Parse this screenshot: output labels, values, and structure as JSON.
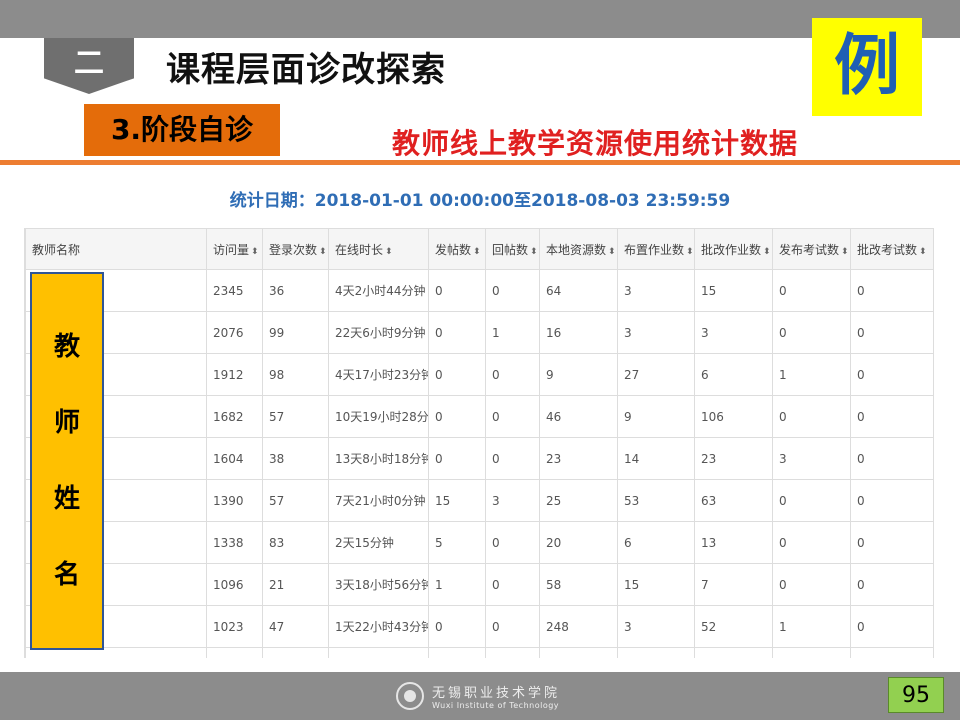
{
  "header": {
    "section_number": "二",
    "main_title": "课程层面诊改探索",
    "example_label": "例",
    "subsection": "3.阶段自诊",
    "subtitle": "教师线上教学资源使用统计数据"
  },
  "stats": {
    "date_range": "统计日期：2018-01-01 00:00:00至2018-08-03 23:59:59"
  },
  "table": {
    "columns": [
      "教师名称",
      "访问量",
      "登录次数",
      "在线时长",
      "发帖数",
      "回帖数",
      "本地资源数",
      "布置作业数",
      "批改作业数",
      "发布考试数",
      "批改考试数"
    ],
    "sortable": [
      false,
      true,
      true,
      true,
      true,
      true,
      true,
      true,
      true,
      true,
      true
    ],
    "sort_icon": "sort-updown-icon",
    "rows": [
      [
        "",
        "2345",
        "36",
        "4天2小时44分钟",
        "0",
        "0",
        "64",
        "3",
        "15",
        "0",
        "0"
      ],
      [
        "",
        "2076",
        "99",
        "22天6小时9分钟",
        "0",
        "1",
        "16",
        "3",
        "3",
        "0",
        "0"
      ],
      [
        "",
        "1912",
        "98",
        "4天17小时23分钟",
        "0",
        "0",
        "9",
        "27",
        "6",
        "1",
        "0"
      ],
      [
        "",
        "1682",
        "57",
        "10天19小时28分钟",
        "0",
        "0",
        "46",
        "9",
        "106",
        "0",
        "0"
      ],
      [
        "",
        "1604",
        "38",
        "13天8小时18分钟",
        "0",
        "0",
        "23",
        "14",
        "23",
        "3",
        "0"
      ],
      [
        "",
        "1390",
        "57",
        "7天21小时0分钟",
        "15",
        "3",
        "25",
        "53",
        "63",
        "0",
        "0"
      ],
      [
        "",
        "1338",
        "83",
        "2天15分钟",
        "5",
        "0",
        "20",
        "6",
        "13",
        "0",
        "0"
      ],
      [
        "",
        "1096",
        "21",
        "3天18小时56分钟",
        "1",
        "0",
        "58",
        "15",
        "7",
        "0",
        "0"
      ],
      [
        "",
        "1023",
        "47",
        "1天22小时43分钟",
        "0",
        "0",
        "248",
        "3",
        "52",
        "1",
        "0"
      ],
      [
        "",
        "",
        "",
        "",
        "",
        "",
        "",
        "",
        "",
        "",
        ""
      ]
    ]
  },
  "name_overlay": {
    "chars": [
      "教",
      "师",
      "姓",
      "名"
    ]
  },
  "footer": {
    "school_cn": "无锡职业技术学院",
    "school_en": "Wuxi Institute of Technology",
    "page_number": "95"
  },
  "colors": {
    "accent_orange": "#ed7d31",
    "subtitle_red": "#e02020",
    "example_yellow": "#ffff00",
    "overlay_gold": "#ffc000",
    "page_green": "#92d050"
  }
}
